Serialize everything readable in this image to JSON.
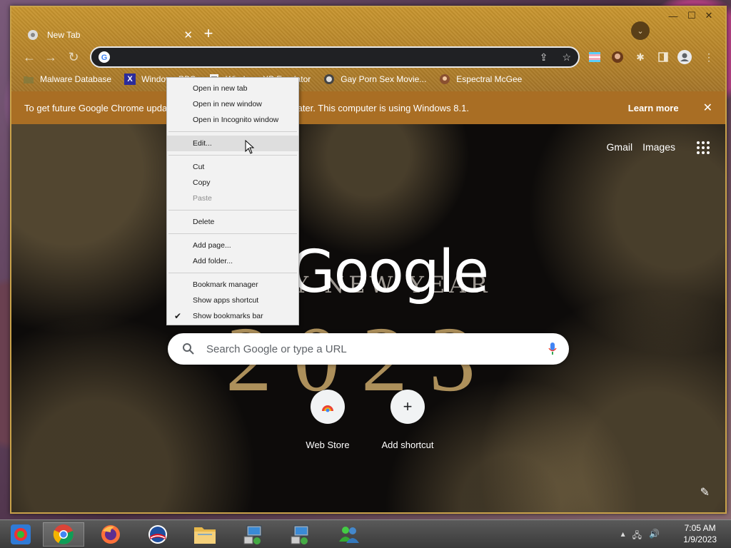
{
  "tab": {
    "title": "New Tab",
    "close_glyph": "✕",
    "new_tab_glyph": "+"
  },
  "window_controls": {
    "minimize": "—",
    "maximize": "☐",
    "close": "✕"
  },
  "tab_search_glyph": "⌄",
  "toolbar": {
    "back": "←",
    "forward": "→",
    "reload": "↻",
    "omnibox_value": "",
    "share_glyph": "⇪",
    "star_glyph": "☆",
    "puzzle_glyph": "✱",
    "menu_glyph": "⋮"
  },
  "bookmarks": [
    {
      "label": "Malware Database",
      "icon": "folder-icon"
    },
    {
      "label": "Windows BBS",
      "icon": "x-site-icon",
      "glyph": "X"
    },
    {
      "label": "Windows XP Emulator",
      "icon": "page-icon"
    },
    {
      "label": "Gay Porn Sex Movie...",
      "icon": "site-icon"
    },
    {
      "label": "Espectral McGee",
      "icon": "avatar-icon"
    }
  ],
  "infobar": {
    "message": "To get future Google Chrome updates, you'll need Windows 10 or later. This computer is using Windows 8.1.",
    "learn_more": "Learn more",
    "close_glyph": "✕"
  },
  "ntp": {
    "gmail": "Gmail",
    "images": "Images",
    "doodle_word": "Google",
    "doodle_sub": "Y NEW YEAR",
    "doodle_year": "2023",
    "search_placeholder": "Search Google or type a URL",
    "shortcuts": [
      {
        "label": "Web Store",
        "icon": "webstore-icon"
      },
      {
        "label": "Add shortcut",
        "icon": "plus-icon",
        "glyph": "+"
      }
    ],
    "customize_glyph": "✎"
  },
  "context_menu": {
    "groups": [
      [
        "Open in new tab",
        "Open in new window",
        "Open in Incognito window"
      ],
      [
        "Edit..."
      ],
      [
        "Cut",
        "Copy",
        "Paste"
      ],
      [
        "Delete"
      ],
      [
        "Add page...",
        "Add folder..."
      ],
      [
        "Bookmark manager",
        "Show apps shortcut",
        "Show bookmarks bar"
      ]
    ],
    "disabled": [
      "Paste"
    ],
    "hovered": "Edit...",
    "checked": "Show bookmarks bar",
    "check_glyph": "✔"
  },
  "taskbar": {
    "apps": [
      "start-icon",
      "chrome-icon",
      "firefox-icon",
      "obama-logo-icon",
      "file-explorer-icon",
      "network-setup-icon",
      "network-setup-icon",
      "msn-messenger-icon"
    ],
    "tray": {
      "up_arrow": "▴",
      "network": "🖧",
      "volume": "🔊"
    },
    "time": "7:05 AM",
    "date": "1/9/2023"
  }
}
